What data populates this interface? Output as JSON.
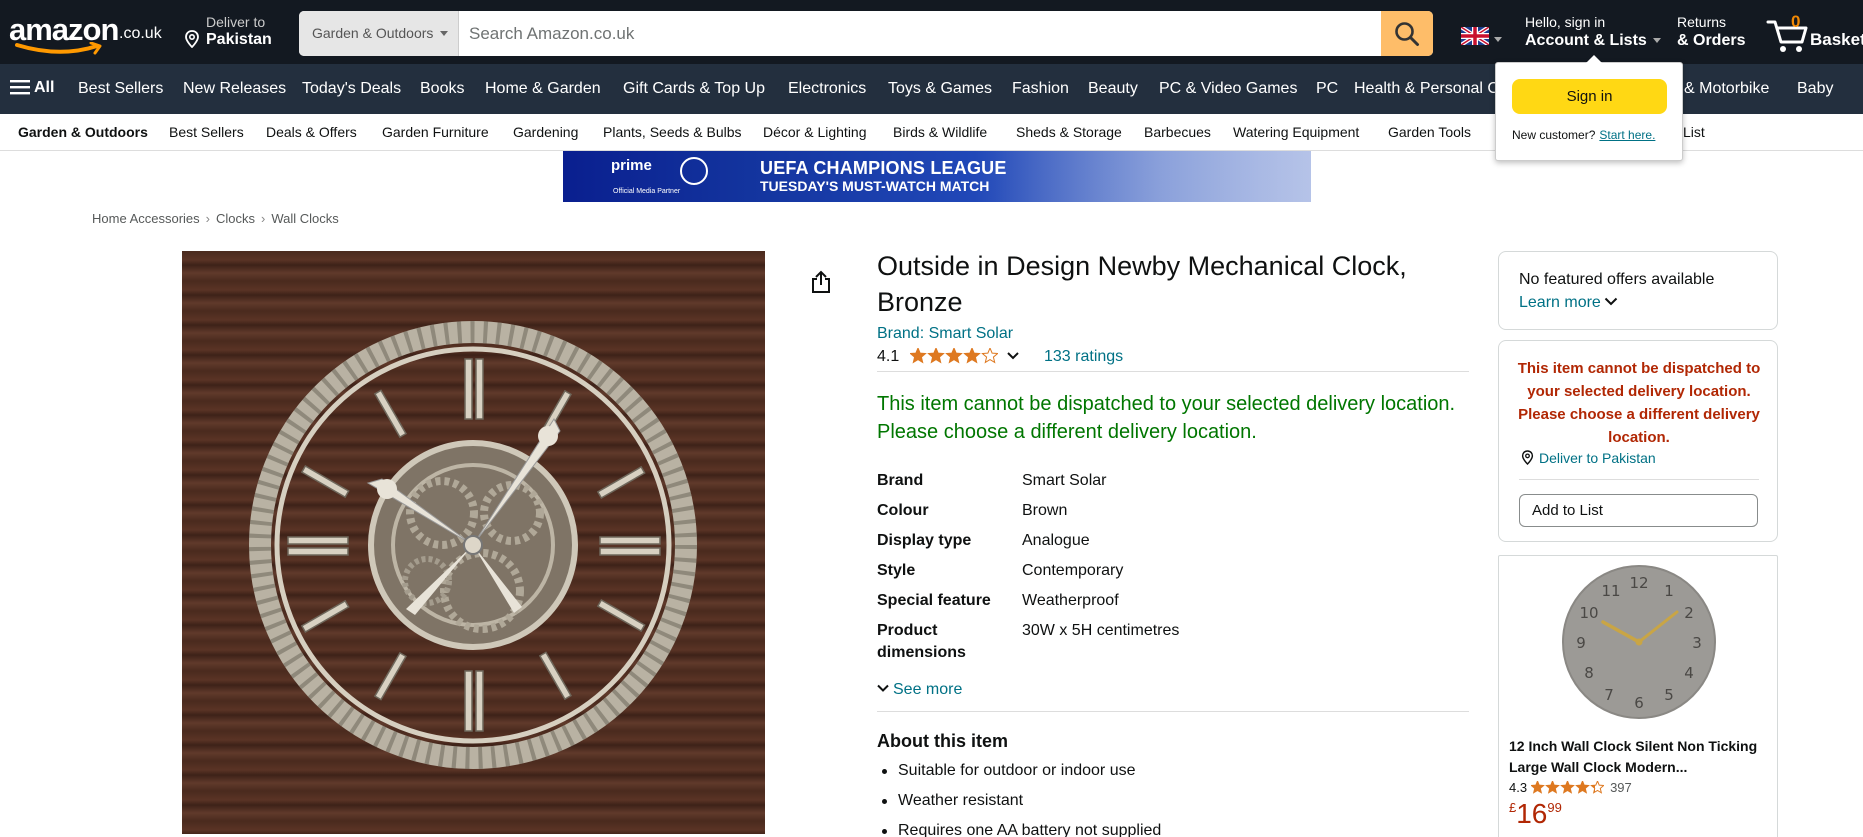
{
  "header": {
    "logo_word": "amazon",
    "logo_tld": ".co.uk",
    "deliver_line1": "Deliver to",
    "deliver_line2": "Pakistan",
    "search_category": "Garden & Outdoors",
    "search_placeholder": "Search Amazon.co.uk",
    "account_line1": "Hello, sign in",
    "account_line2": "Account & Lists",
    "returns_line1": "Returns",
    "returns_line2": "& Orders",
    "basket_count": "0",
    "basket_label": "Basket"
  },
  "main_nav": {
    "all_label": "All",
    "items": [
      "Best Sellers",
      "New Releases",
      "Today's Deals",
      "Books",
      "Home & Garden",
      "Gift Cards & Top Up",
      "Electronics",
      "Toys & Games",
      "Fashion",
      "Beauty",
      "PC & Video Games",
      "PC",
      "Health & Personal C",
      "& Motorbike",
      "Baby"
    ]
  },
  "sub_nav": {
    "items": [
      "Garden & Outdoors",
      "Best Sellers",
      "Deals & Offers",
      "Garden Furniture",
      "Gardening",
      "Plants, Seeds & Bulbs",
      "Décor & Lighting",
      "Birds & Wildlife",
      "Sheds & Storage",
      "Barbecues",
      "Watering Equipment",
      "Garden Tools",
      "List"
    ]
  },
  "banner": {
    "prime": "prime",
    "partner": "Official Media Partner",
    "line1": "UEFA CHAMPIONS LEAGUE",
    "line2": "TUESDAY'S MUST-WATCH MATCH"
  },
  "breadcrumb": [
    "Home Accessories",
    "Clocks",
    "Wall Clocks"
  ],
  "product": {
    "title": "Outside in Design Newby Mechanical Clock, Bronze",
    "brand_link": "Brand: Smart Solar",
    "rating_value": "4.1",
    "rating_stars": 4.1,
    "ratings_count": "133 ratings",
    "unavailable_msg": "This item cannot be dispatched to your selected delivery location. Please choose a different delivery location.",
    "specs": [
      {
        "key": "Brand",
        "value": "Smart Solar"
      },
      {
        "key": "Colour",
        "value": "Brown"
      },
      {
        "key": "Display type",
        "value": "Analogue"
      },
      {
        "key": "Style",
        "value": "Contemporary"
      },
      {
        "key": "Special feature",
        "value": "Weatherproof"
      },
      {
        "key": "Product dimensions",
        "value": "30W x 5H centimetres"
      }
    ],
    "see_more": "See more",
    "about_heading": "About this item",
    "about_items": [
      "Suitable for outdoor or indoor use",
      "Weather resistant",
      "Requires one AA battery not supplied"
    ]
  },
  "buy_box": {
    "no_offers": "No featured offers available",
    "learn_more": "Learn more",
    "warning": "This item cannot be dispatched to your selected delivery location. Please choose a different delivery location.",
    "deliver_to": "Deliver to Pakistan",
    "add_to_list": "Add to List"
  },
  "sponsored": {
    "name": "12 Inch Wall Clock Silent Non Ticking Large Wall Clock Modern...",
    "rating_value": "4.3",
    "rating_stars": 4.3,
    "rating_count": "397",
    "price_currency": "£",
    "price_whole": "16",
    "price_fraction": "99"
  },
  "signin_flyout": {
    "button": "Sign in",
    "new_customer": "New customer?",
    "start_here": "Start here."
  },
  "colors": {
    "nav_dark": "#131921",
    "nav_secondary": "#232f3e",
    "search_button": "#febd69",
    "link": "#007185",
    "success": "#007600",
    "warning": "#b12704",
    "star": "#de7921",
    "signin_button": "#ffd814"
  }
}
